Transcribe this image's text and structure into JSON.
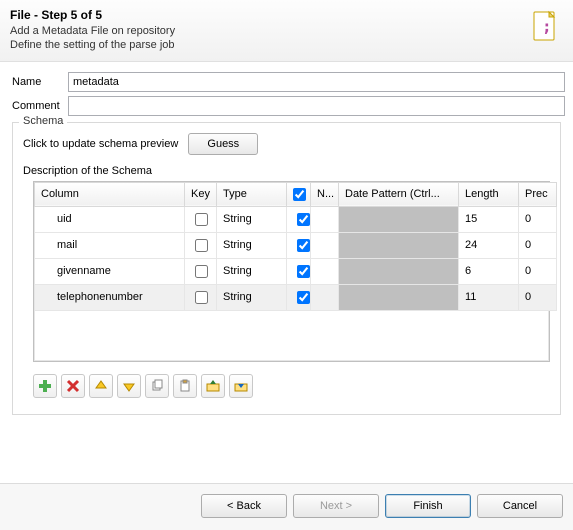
{
  "banner": {
    "title": "File - Step 5 of 5",
    "line1": "Add a Metadata File on repository",
    "line2": "Define the setting of the parse job"
  },
  "form": {
    "name_label": "Name",
    "name_value": "metadata",
    "comment_label": "Comment",
    "comment_value": ""
  },
  "schema": {
    "legend": "Schema",
    "guess_label": "Click to update schema preview",
    "guess_button": "Guess",
    "desc_label": "Description of the Schema",
    "headers": {
      "column": "Column",
      "key": "Key",
      "type": "Type",
      "n": "N...",
      "date_pattern": "Date Pattern (Ctrl...",
      "length": "Length",
      "prec": "Prec"
    },
    "rows": [
      {
        "column": "uid",
        "type": "String",
        "length": "15",
        "prec": "0"
      },
      {
        "column": "mail",
        "type": "String",
        "length": "24",
        "prec": "0"
      },
      {
        "column": "givenname",
        "type": "String",
        "length": "6",
        "prec": "0"
      },
      {
        "column": "telephonenumber",
        "type": "String",
        "length": "11",
        "prec": "0"
      }
    ]
  },
  "footer": {
    "back": "< Back",
    "next": "Next >",
    "finish": "Finish",
    "cancel": "Cancel"
  }
}
